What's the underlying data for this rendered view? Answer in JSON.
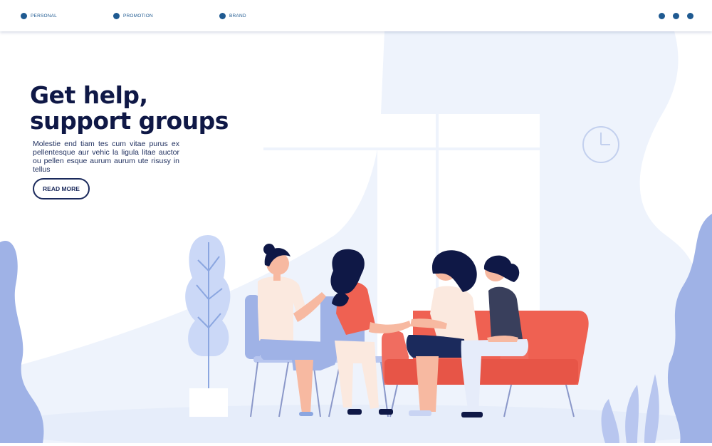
{
  "nav": {
    "items": [
      {
        "label": "PERSONAL"
      },
      {
        "label": "PROMOTION"
      },
      {
        "label": "BRAND"
      }
    ],
    "menu_icon": "more-dots-icon"
  },
  "hero": {
    "title_line1": "Get help,",
    "title_line2": "support groups",
    "body": "Molestie end tiam tes cum vitae purus ex pellentesque aur vehic la ligula litae auctor ou pellen esque aurum aurum ute risusy in tellus",
    "cta_label": "READ MORE"
  },
  "colors": {
    "navy": "#0f1846",
    "accent_blue": "#1f5a91",
    "light_blue": "#eef3fc",
    "sofa_red": "#ef6152",
    "foliage": "#9fb2e6"
  }
}
